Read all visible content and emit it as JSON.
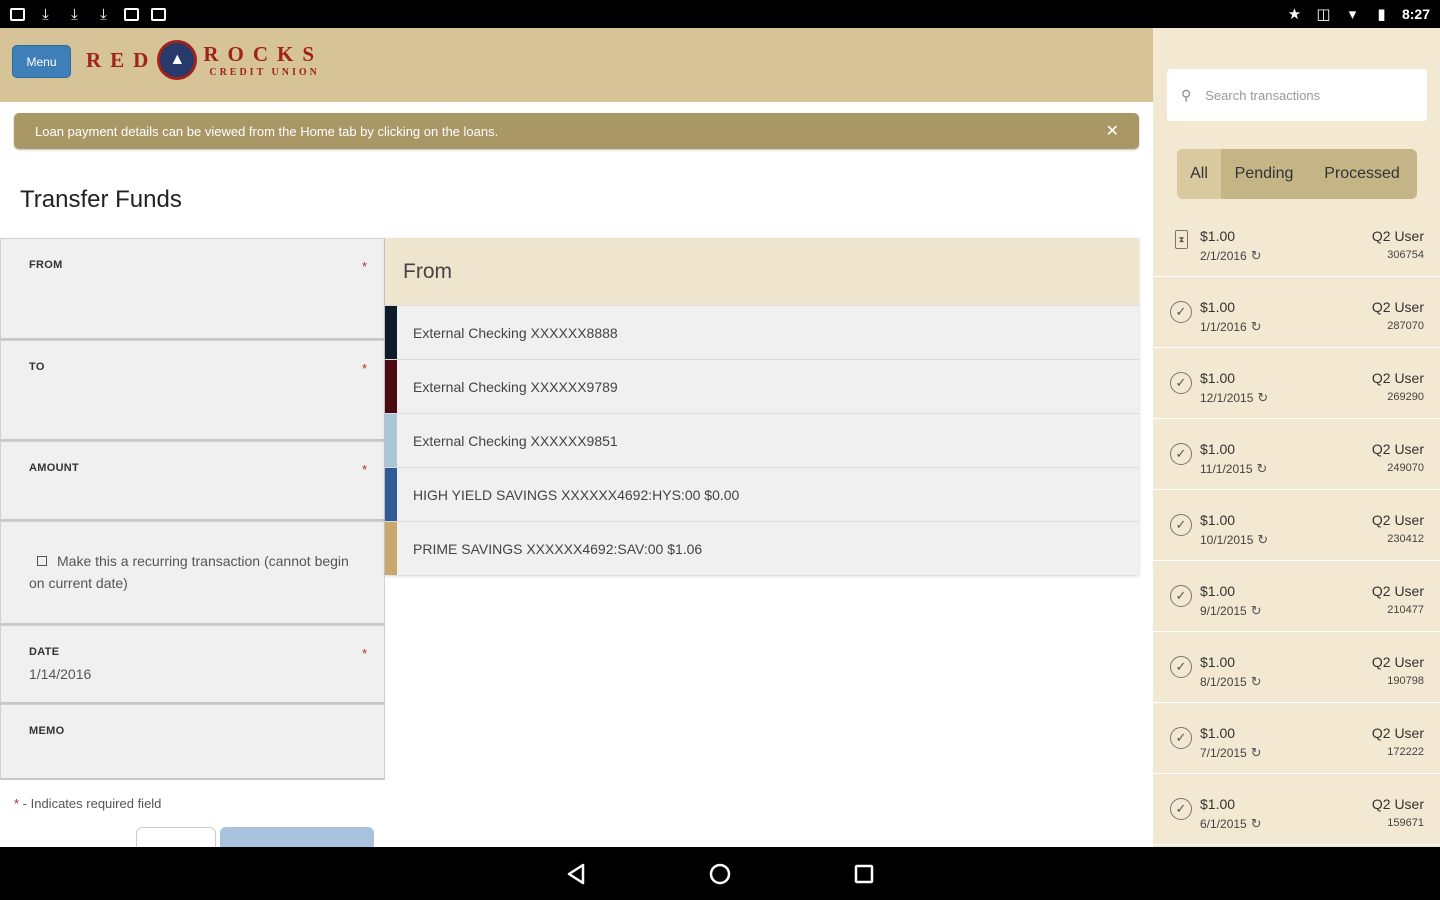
{
  "status_bar": {
    "time": "8:27",
    "left_icons": [
      "image-icon",
      "download-icon",
      "download-icon",
      "download-icon",
      "camera-icon",
      "gallery-icon"
    ],
    "right_icons": [
      "star-icon",
      "vibrate-icon",
      "wifi-icon",
      "battery-icon"
    ]
  },
  "header": {
    "menu_label": "Menu",
    "logo_left": "RED",
    "logo_right": "ROCKS",
    "logo_sub": "CREDIT UNION"
  },
  "notice": {
    "text": "Loan payment details can be viewed from the Home tab by clicking on the loans.",
    "close": "✕"
  },
  "page_title": "Transfer Funds",
  "form": {
    "required_star": "*",
    "from_label": "FROM",
    "to_label": "TO",
    "amount_label": "AMOUNT",
    "recurring_text": "Make this a recurring transaction (cannot begin on current date)",
    "date_label": "DATE",
    "date_value": "1/14/2016",
    "memo_label": "MEMO",
    "required_note_star": "*",
    "required_note": " - Indicates required field"
  },
  "from_panel": {
    "title": "From",
    "accounts": [
      {
        "label": "External Checking XXXXXX8888",
        "color": "#0e1a2b"
      },
      {
        "label": "External Checking XXXXXX9789",
        "color": "#4a0a10"
      },
      {
        "label": "External Checking XXXXXX9851",
        "color": "#a9c7d8"
      },
      {
        "label": "HIGH YIELD SAVINGS XXXXXX4692:HYS:00 $0.00",
        "color": "#2f5a93"
      },
      {
        "label": "PRIME SAVINGS XXXXXX4692:SAV:00 $1.06",
        "color": "#c9a870"
      }
    ]
  },
  "sidebar": {
    "search_placeholder": "Search transactions",
    "filters": [
      "All",
      "Pending",
      "Processed"
    ],
    "active_filter": "All",
    "transactions": [
      {
        "amount": "$1.00",
        "date": "2/1/2016",
        "user": "Q2 User",
        "id": "306754",
        "icon": "pending"
      },
      {
        "amount": "$1.00",
        "date": "1/1/2016",
        "user": "Q2 User",
        "id": "287070",
        "icon": "check"
      },
      {
        "amount": "$1.00",
        "date": "12/1/2015",
        "user": "Q2 User",
        "id": "269290",
        "icon": "check"
      },
      {
        "amount": "$1.00",
        "date": "11/1/2015",
        "user": "Q2 User",
        "id": "249070",
        "icon": "check"
      },
      {
        "amount": "$1.00",
        "date": "10/1/2015",
        "user": "Q2 User",
        "id": "230412",
        "icon": "check"
      },
      {
        "amount": "$1.00",
        "date": "9/1/2015",
        "user": "Q2 User",
        "id": "210477",
        "icon": "check"
      },
      {
        "amount": "$1.00",
        "date": "8/1/2015",
        "user": "Q2 User",
        "id": "190798",
        "icon": "check"
      },
      {
        "amount": "$1.00",
        "date": "7/1/2015",
        "user": "Q2 User",
        "id": "172222",
        "icon": "check"
      },
      {
        "amount": "$1.00",
        "date": "6/1/2015",
        "user": "Q2 User",
        "id": "159671",
        "icon": "check"
      }
    ]
  },
  "colors": {
    "header_bg": "#d6c498",
    "notice_bg": "#a99766",
    "sidebar_bg": "#f3e9d2",
    "menu_button": "#3f7fb9",
    "brand_red": "#a0221c"
  }
}
